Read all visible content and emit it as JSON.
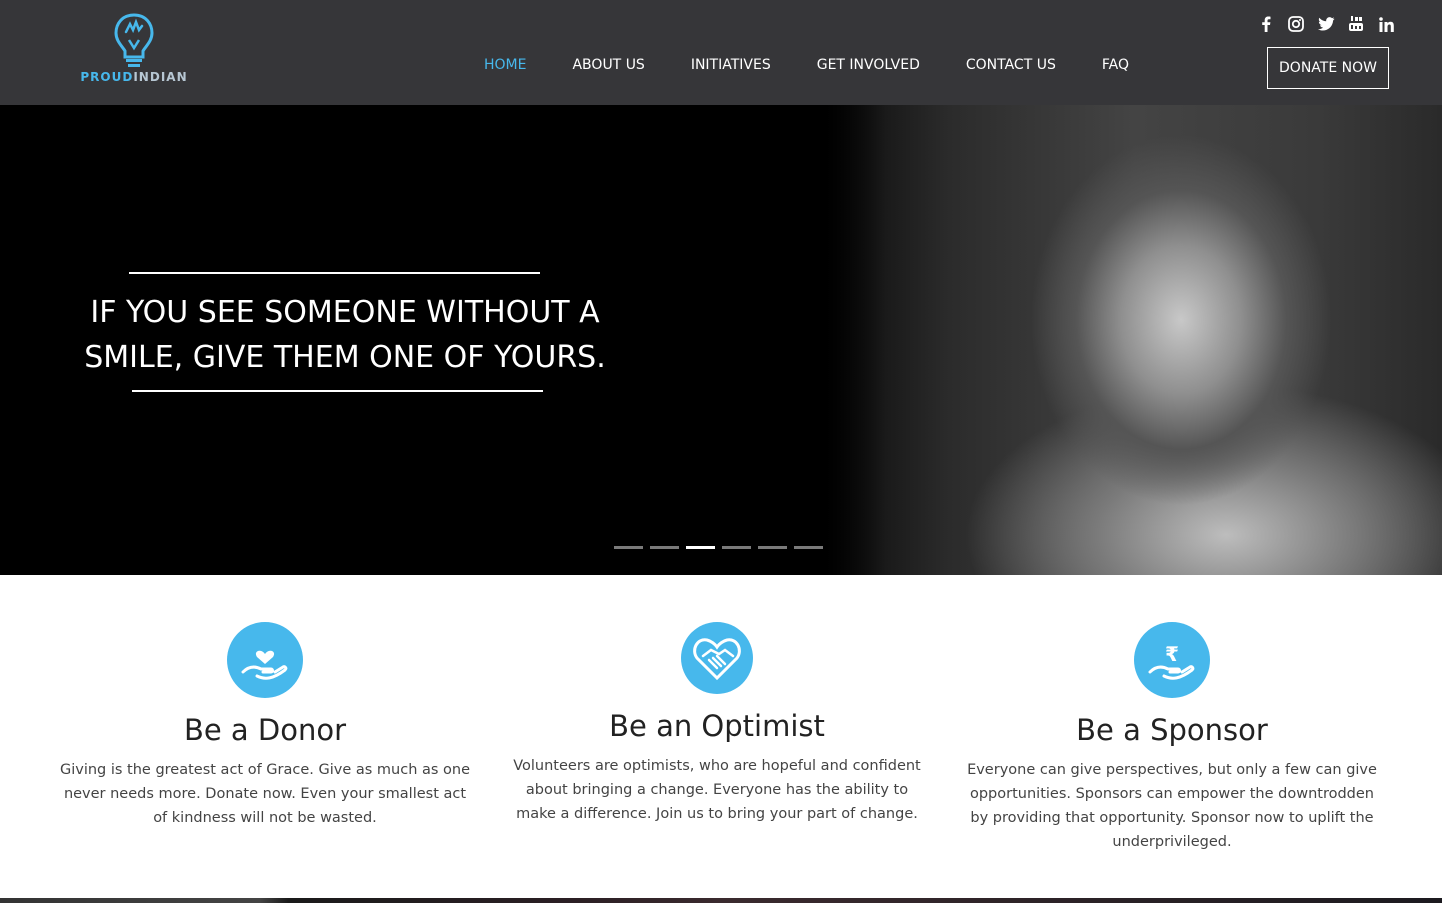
{
  "brand": {
    "logo_part1": "PROUD",
    "logo_part2": "INDIAN",
    "accent": "#47b8ec",
    "header_bg": "#363639"
  },
  "nav": {
    "items": [
      {
        "label": "HOME",
        "active": true
      },
      {
        "label": "ABOUT US",
        "active": false
      },
      {
        "label": "INITIATIVES",
        "active": false
      },
      {
        "label": "GET INVOLVED",
        "active": false
      },
      {
        "label": "CONTACT US",
        "active": false
      },
      {
        "label": "FAQ",
        "active": false
      }
    ]
  },
  "social": {
    "icons": [
      "facebook-icon",
      "instagram-icon",
      "twitter-icon",
      "youtube-icon",
      "linkedin-icon"
    ]
  },
  "header": {
    "donate_label": "DONATE NOW"
  },
  "hero": {
    "quote_line1": "IF YOU SEE SOMEONE WITHOUT A",
    "quote_line2": "SMILE, GIVE THEM ONE OF YOURS.",
    "slides_total": 6,
    "active_slide": 3
  },
  "features": [
    {
      "icon": "heart-in-hand-icon",
      "title": "Be a Donor",
      "text": "Giving is the greatest act of Grace. Give as much as one never needs more. Donate now. Even your smallest act of kindness will not be wasted."
    },
    {
      "icon": "handshake-heart-icon",
      "title": "Be an Optimist",
      "text": "Volunteers are optimists, who are hopeful and confident about bringing a change. Everyone has the ability to make a difference. Join us to bring your part of change."
    },
    {
      "icon": "rupee-in-hand-icon",
      "title": "Be a Sponsor",
      "text": "Everyone can give perspectives, but only a few can give opportunities. Sponsors can empower the downtrodden by providing that opportunity. Sponsor now to uplift the underprivileged."
    }
  ]
}
